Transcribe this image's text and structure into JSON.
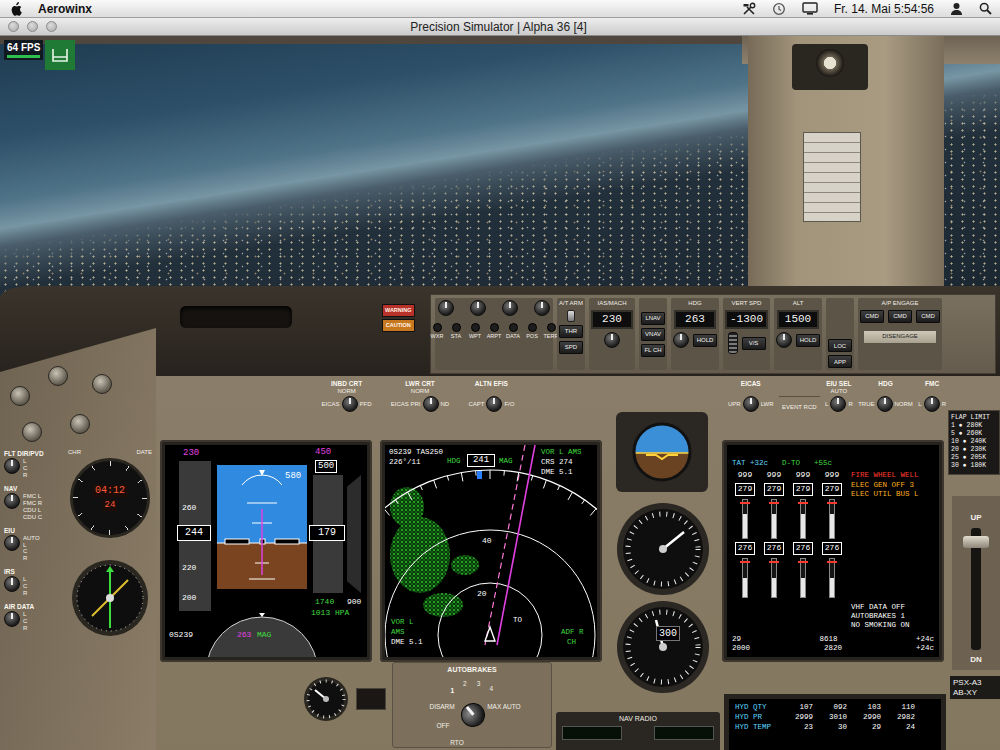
{
  "menubar": {
    "app": "Aerowinx",
    "clock": "Fr. 14. Mai 5:54:56"
  },
  "window": {
    "title": "Precision Simulator | Alpha 36 [4]"
  },
  "fps": "64 FPS",
  "annunciators": [
    {
      "label": "WARNING",
      "color": "#b8322a"
    },
    {
      "label": "CAUTION",
      "color": "#c7781e"
    }
  ],
  "mcp": {
    "efis_buttons": [
      "WXR",
      "STA",
      "WPT",
      "ARPT",
      "DATA",
      "POS",
      "TERR"
    ],
    "autothrottle": {
      "label": "A/T ARM",
      "buttons": [
        "THR",
        "SPD"
      ]
    },
    "speed": {
      "label": "IAS/MACH",
      "value": "230"
    },
    "lateral_buttons": [
      "LNAV",
      "VNAV",
      "FL CH"
    ],
    "heading": {
      "label": "HDG",
      "value": "263",
      "button": "HOLD"
    },
    "vertical_speed": {
      "label": "VERT SPD",
      "value": "-1300",
      "button": "V/S"
    },
    "altitude": {
      "label": "ALT",
      "value": "1500",
      "button": "HOLD"
    },
    "approach_buttons": [
      "LOC",
      "APP"
    ],
    "autopilot": {
      "label": "A/P ENGAGE",
      "buttons": [
        "CMD",
        "CMD",
        "CMD"
      ],
      "disengage": "DISENGAGE"
    }
  },
  "efis_selectors": [
    {
      "title": "INBD CRT",
      "options": [
        "NORM",
        "EICAS",
        "PFD"
      ]
    },
    {
      "title": "LWR CRT",
      "options": [
        "NORM",
        "EICAS PRI",
        "ND"
      ]
    },
    {
      "title": "ALTN EFIS",
      "options": [
        "CAPT",
        "F/O"
      ]
    }
  ],
  "right_selectors": [
    {
      "title": "EICAS",
      "options": [
        "UPR",
        "LWR"
      ]
    },
    {
      "title": "EIU SEL",
      "options": [
        "AUTO",
        "L",
        "R"
      ]
    },
    {
      "title": "HDG",
      "options": [
        "TRUE",
        "NORM"
      ]
    },
    {
      "title": "FMC",
      "options": [
        "L",
        "R"
      ]
    }
  ],
  "event_button": "EVENT RCD",
  "left_selectors": [
    {
      "title": "FLT DIR/PVD",
      "options": [
        "L",
        "C",
        "R"
      ]
    },
    {
      "title": "NAV",
      "options": [
        "FMC L",
        "FMC R",
        "CDU L",
        "CDU C"
      ]
    },
    {
      "title": "EIU",
      "options": [
        "AUTO",
        "L",
        "C",
        "R"
      ]
    },
    {
      "title": "IRS",
      "options": [
        "L",
        "C",
        "R"
      ]
    },
    {
      "title": "AIR DATA",
      "options": [
        "L",
        "C",
        "R"
      ]
    }
  ],
  "clock": {
    "chrono_label": "CHR",
    "date_label": "DATE",
    "time": "04:12",
    "date": "24"
  },
  "pfd": {
    "speed_target": "230",
    "speed": "244",
    "speed_ticks": [
      "260",
      "220",
      "200"
    ],
    "radio_alt": "580",
    "alt_target": "450",
    "alt_bug": "500",
    "altitude": "179",
    "baro_alt": "1740",
    "vs_limit": "900",
    "baro": "1013 HPA",
    "heading": "263",
    "heading_ref": "MAG",
    "ground_speed": "0S239"
  },
  "nd": {
    "source": "0S239 TAS250",
    "wind": "226°/11",
    "hdg_label": "HDG",
    "heading": "241",
    "ref": "MAG",
    "nav_top": "VOR L AMS",
    "course": "CRS 274",
    "dme_top": "DME 5.1",
    "ranges": [
      "40",
      "20"
    ],
    "to": "TO",
    "nav_bottom": [
      "VOR L",
      "AMS",
      "DME 5.1"
    ],
    "adf": [
      "ADF R",
      "CH"
    ]
  },
  "standby": {
    "altitude": "300"
  },
  "eicas": {
    "tat": "TAT +32c",
    "mode": "D-TO",
    "temp": "+55c",
    "engines": [
      {
        "epr": "999",
        "n1": "279",
        "n1_level": 0.62,
        "egt": "276",
        "egt_level": 0.5
      },
      {
        "epr": "999",
        "n1": "279",
        "n1_level": 0.62,
        "egt": "276",
        "egt_level": 0.5
      },
      {
        "epr": "999",
        "n1": "279",
        "n1_level": 0.62,
        "egt": "276",
        "egt_level": 0.5
      },
      {
        "epr": "999",
        "n1": "279",
        "n1_level": 0.62,
        "egt": "276",
        "egt_level": 0.5
      }
    ],
    "alerts": [
      {
        "text": "FIRE WHEEL WELL",
        "color": "#ff3b30"
      },
      {
        "text": "ELEC GEN OFF 3",
        "color": "#ffb020"
      },
      {
        "text": "ELEC UTIL BUS L",
        "color": "#ffb020"
      }
    ],
    "memos": [
      "VHF DATA OFF",
      "AUTOBRAKES 1",
      "NO SMOKING ON"
    ],
    "bottom": [
      [
        "29",
        "8618",
        "+24c"
      ],
      [
        "2000",
        "2820",
        "+24c"
      ]
    ]
  },
  "flap_limits": {
    "title": "FLAP LIMIT",
    "rows": [
      "1 ● 280K",
      "5 ● 260K",
      "10 ● 240K",
      "20 ● 230K",
      "25 ● 205K",
      "30 ● 180K"
    ]
  },
  "flap_lever": {
    "up": "UP",
    "down": "DN"
  },
  "registration": [
    "PSX-A3",
    "AB-XY"
  ],
  "autobrakes": {
    "title": "AUTOBRAKES",
    "positions": [
      {
        "label": "RTO",
        "selected": false
      },
      {
        "label": "OFF",
        "selected": false
      },
      {
        "label": "DISARM",
        "selected": false
      },
      {
        "label": "1",
        "selected": true
      },
      {
        "label": "2",
        "selected": false
      },
      {
        "label": "3",
        "selected": false
      },
      {
        "label": "4",
        "selected": false
      },
      {
        "label": "MAX AUTO",
        "selected": false
      }
    ]
  },
  "nav_radio": {
    "title": "NAV RADIO"
  },
  "lower_eicas": [
    {
      "label": "HYD QTY",
      "values": [
        "107",
        "092",
        "103",
        "110"
      ]
    },
    {
      "label": "HYD PR",
      "values": [
        "2999",
        "3010",
        "2990",
        "2982"
      ]
    },
    {
      "label": "HYD TEMP",
      "values": [
        "23",
        "30",
        "29",
        "24"
      ]
    }
  ]
}
